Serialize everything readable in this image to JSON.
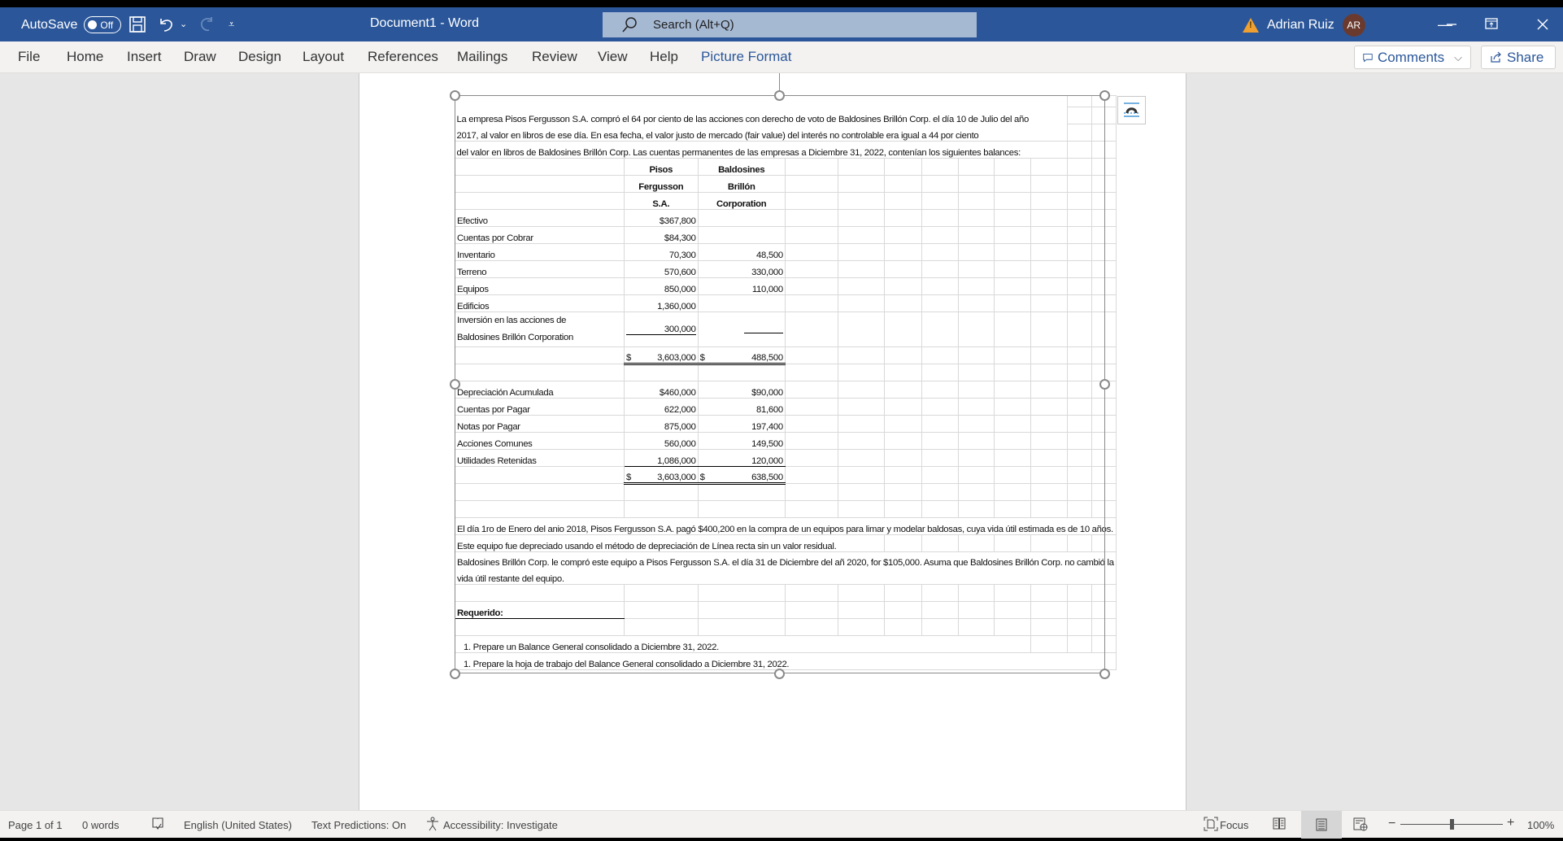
{
  "titlebar": {
    "autosave_label": "AutoSave",
    "autosave_state": "Off",
    "document_title": "Document1  -  Word",
    "search_placeholder": "Search (Alt+Q)",
    "user_name": "Adrian Ruiz",
    "user_initials": "AR",
    "icons": [
      "save-icon",
      "undo-icon",
      "redo-icon",
      "customize-qat-icon",
      "warning-icon",
      "ribbon-display-icon",
      "minimize-icon",
      "restore-icon",
      "close-icon"
    ]
  },
  "ribbon": {
    "tabs": [
      "File",
      "Home",
      "Insert",
      "Draw",
      "Design",
      "Layout",
      "References",
      "Mailings",
      "Review",
      "View",
      "Help",
      "Picture Format"
    ],
    "active_tab": "Picture Format",
    "comments_label": "Comments",
    "share_label": "Share"
  },
  "document": {
    "intro_lines": [
      "La empresa Pisos Fergusson S.A. compró el 64 por ciento de las acciones con derecho de voto de Baldosines Brillón Corp. el día 10 de Julio del año",
      "2017, al valor en libros de ese día. En esa fecha, el valor justo de mercado (fair value) del interés no controlable era igual a 44 por ciento",
      "del valor en libros de Baldosines Brillón Corp. Las cuentas permanentes de las empresas a Diciembre 31, 2022, contenían los siguientes balances:"
    ],
    "headers": {
      "col1": [
        "Pisos",
        "Fergusson",
        "S.A."
      ],
      "col2": [
        "Baldosines",
        "Brillón",
        "Corporation"
      ]
    },
    "assets": [
      {
        "label": "Efectivo",
        "a": "$367,800",
        "b": ""
      },
      {
        "label": "Cuentas por Cobrar",
        "a": "$84,300",
        "b": ""
      },
      {
        "label": "Inventario",
        "a": "70,300",
        "b": "48,500"
      },
      {
        "label": "Terreno",
        "a": "570,600",
        "b": "330,000"
      },
      {
        "label": "Equipos",
        "a": "850,000",
        "b": "110,000"
      },
      {
        "label": "Edificios",
        "a": "1,360,000",
        "b": ""
      }
    ],
    "investment": {
      "label1": "Inversión en las acciones de",
      "label2": "Baldosines Brillón Corporation",
      "a": "300,000",
      "b": ""
    },
    "assets_total": {
      "a_sign": "$",
      "a": "3,603,000",
      "b_sign": "$",
      "b": "488,500"
    },
    "liabilities": [
      {
        "label": "Depreciación Acumulada",
        "a": "$460,000",
        "b": "$90,000"
      },
      {
        "label": "Cuentas por Pagar",
        "a": "622,000",
        "b": "81,600"
      },
      {
        "label": "Notas por Pagar",
        "a": "875,000",
        "b": "197,400"
      },
      {
        "label": "Acciones Comunes",
        "a": "560,000",
        "b": "149,500"
      },
      {
        "label": "Utilidades Retenidas",
        "a": "1,086,000",
        "b": "120,000"
      }
    ],
    "liabilities_total": {
      "a_sign": "$",
      "a": "3,603,000",
      "b_sign": "$",
      "b": "638,500"
    },
    "paragraph_lines": [
      "El día 1ro de Enero del anio 2018, Pisos Fergusson S.A. pagó $400,200 en la compra de un equipos para limar y modelar baldosas, cuya vida útil estimada es de 10 años.",
      "Este equipo fue depreciado usando el método de depreciación de Línea recta sin un valor residual.",
      "Baldosines Brillón Corp. le compró este equipo a Pisos Fergusson S.A. el día 31 de Diciembre del añ 2020, for $105,000. Asuma que Baldosines Brillón Corp. no cambió la",
      "vida útil restante del equipo."
    ],
    "required_label": "Requerido:",
    "required_items": [
      "1. Prepare un Balance General consolidado a Diciembre 31, 2022.",
      "1. Prepare la hoja de trabajo del Balance General consolidado a Diciembre 31, 2022."
    ]
  },
  "statusbar": {
    "page": "Page 1 of 1",
    "words": "0 words",
    "language": "English (United States)",
    "text_predictions": "Text Predictions: On",
    "accessibility": "Accessibility: Investigate",
    "focus_label": "Focus",
    "zoom_level": "100%",
    "zoom_fraction": 0.5
  }
}
